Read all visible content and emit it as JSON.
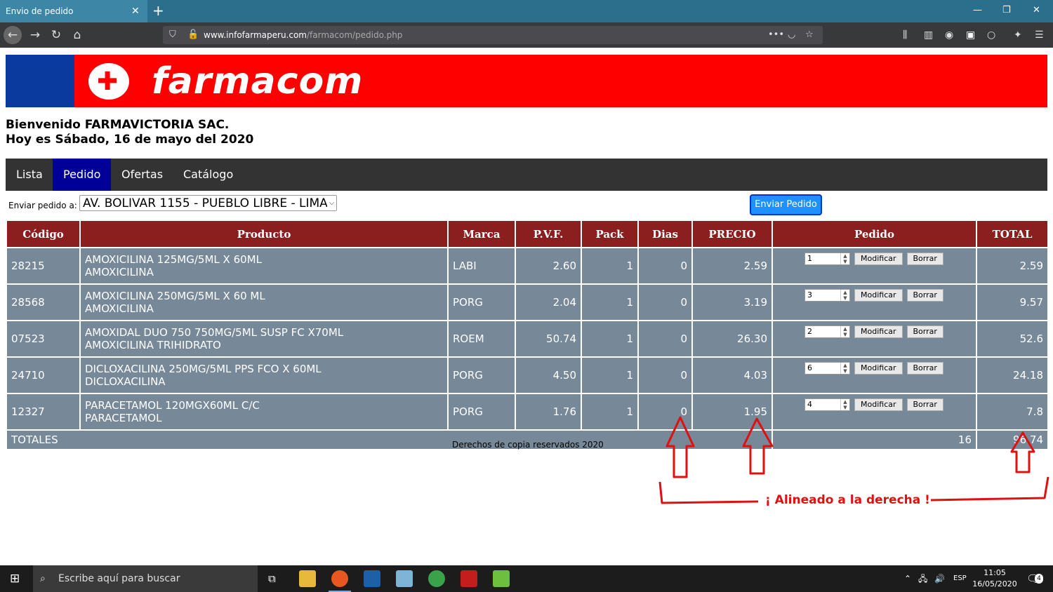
{
  "browser": {
    "tab_title": "Envio de pedido",
    "url_domain": "www.infofarmaperu.com",
    "url_path": "/farmacom/pedido.php"
  },
  "banner": {
    "logo_text": "farmacom"
  },
  "welcome": {
    "line1": "Bienvenido FARMAVICTORIA SAC.",
    "line2": "Hoy es Sábado, 16 de mayo del 2020"
  },
  "menu": [
    "Lista",
    "Pedido",
    "Ofertas",
    "Catálogo"
  ],
  "send": {
    "label": "Enviar pedido a:",
    "selected": "AV. BOLIVAR 1155 - PUEBLO LIBRE - LIMA",
    "button": "Enviar Pedido"
  },
  "table": {
    "headers": [
      "Código",
      "Producto",
      "Marca",
      "P.V.F.",
      "Pack",
      "Dias",
      "PRECIO",
      "Pedido",
      "TOTAL"
    ],
    "rows": [
      {
        "codigo": "28215",
        "producto1": "AMOXICILINA 125MG/5ML X 60ML",
        "producto2": "AMOXICILINA",
        "marca": "LABI",
        "pvf": "2.60",
        "pack": "1",
        "dias": "0",
        "precio": "2.59",
        "qty": "1",
        "total": "2.59"
      },
      {
        "codigo": "28568",
        "producto1": "AMOXICILINA 250MG/5ML X 60 ML",
        "producto2": "AMOXICILINA",
        "marca": "PORG",
        "pvf": "2.04",
        "pack": "1",
        "dias": "0",
        "precio": "3.19",
        "qty": "3",
        "total": "9.57"
      },
      {
        "codigo": "07523",
        "producto1": "AMOXIDAL DUO 750 750MG/5ML SUSP FC X70ML",
        "producto2": "AMOXICILINA TRIHIDRATO",
        "marca": "ROEM",
        "pvf": "50.74",
        "pack": "1",
        "dias": "0",
        "precio": "26.30",
        "qty": "2",
        "total": "52.6"
      },
      {
        "codigo": "24710",
        "producto1": "DICLOXACILINA 250MG/5ML PPS FCO X 60ML",
        "producto2": "DICLOXACILINA",
        "marca": "PORG",
        "pvf": "4.50",
        "pack": "1",
        "dias": "0",
        "precio": "4.03",
        "qty": "6",
        "total": "24.18"
      },
      {
        "codigo": "12327",
        "producto1": "PARACETAMOL 120MGX60ML C/C",
        "producto2": "PARACETAMOL",
        "marca": "PORG",
        "pvf": "1.76",
        "pack": "1",
        "dias": "0",
        "precio": "1.95",
        "qty": "4",
        "total": "7.8"
      }
    ],
    "modify_label": "Modificar",
    "delete_label": "Borrar",
    "totals_label": "TOTALES",
    "totals_qty": "16",
    "totals_amount": "96.74"
  },
  "footer": {
    "copyright": "Derechos de copia reservados 2020"
  },
  "annotation": {
    "text": "¡ Alineado a la derecha !",
    "color": "#e01010"
  },
  "taskbar": {
    "search_placeholder": "Escribe aquí para buscar",
    "lang": "ESP",
    "time": "11:05",
    "date": "16/05/2020",
    "notifications": "4"
  }
}
